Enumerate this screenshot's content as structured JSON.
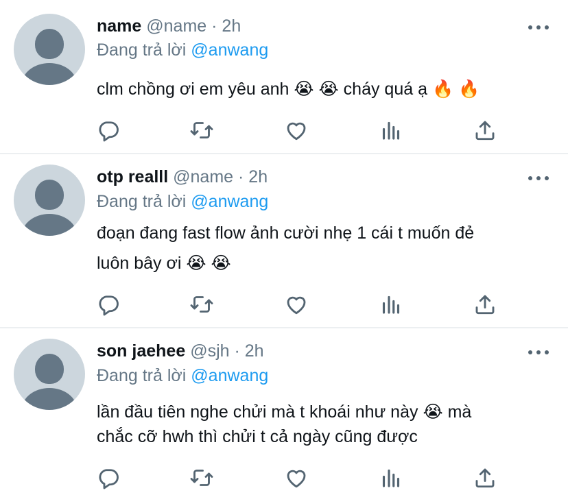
{
  "replying_prefix": "Đang trả lời",
  "tweets": [
    {
      "display_name": "name",
      "handle": "@name",
      "separator": "·",
      "time": "2h",
      "replying_to": "@anwang",
      "content_lines": [
        "clm chồng ơi em yêu anh 😭 😭  cháy quá ạ 🔥 🔥"
      ]
    },
    {
      "display_name": "otp realll",
      "handle": "@name",
      "separator": "·",
      "time": "2h",
      "replying_to": "@anwang",
      "content_lines": [
        "đoạn đang fast flow ảnh cười nhẹ 1 cái t muốn đẻ",
        "luôn bây ơi 😭 😭"
      ]
    },
    {
      "display_name": "son jaehee",
      "handle": "@sjh",
      "separator": "·",
      "time": "2h",
      "replying_to": "@anwang",
      "content_lines": [
        "lần đầu tiên nghe chửi mà t khoái như này 😭  mà",
        "chắc cỡ hwh thì chửi t cả ngày cũng được"
      ]
    }
  ],
  "icons": {
    "reply": "reply-icon",
    "retweet": "retweet-icon",
    "like": "like-icon",
    "views": "views-icon",
    "share": "share-icon",
    "more": "more-icon"
  },
  "colors": {
    "icon": "#536471",
    "mention": "#1d9bf0",
    "secondary_text": "#657786",
    "avatar_bg": "#ccd6dd",
    "avatar_fg": "#657786",
    "divider": "#eceff1"
  }
}
